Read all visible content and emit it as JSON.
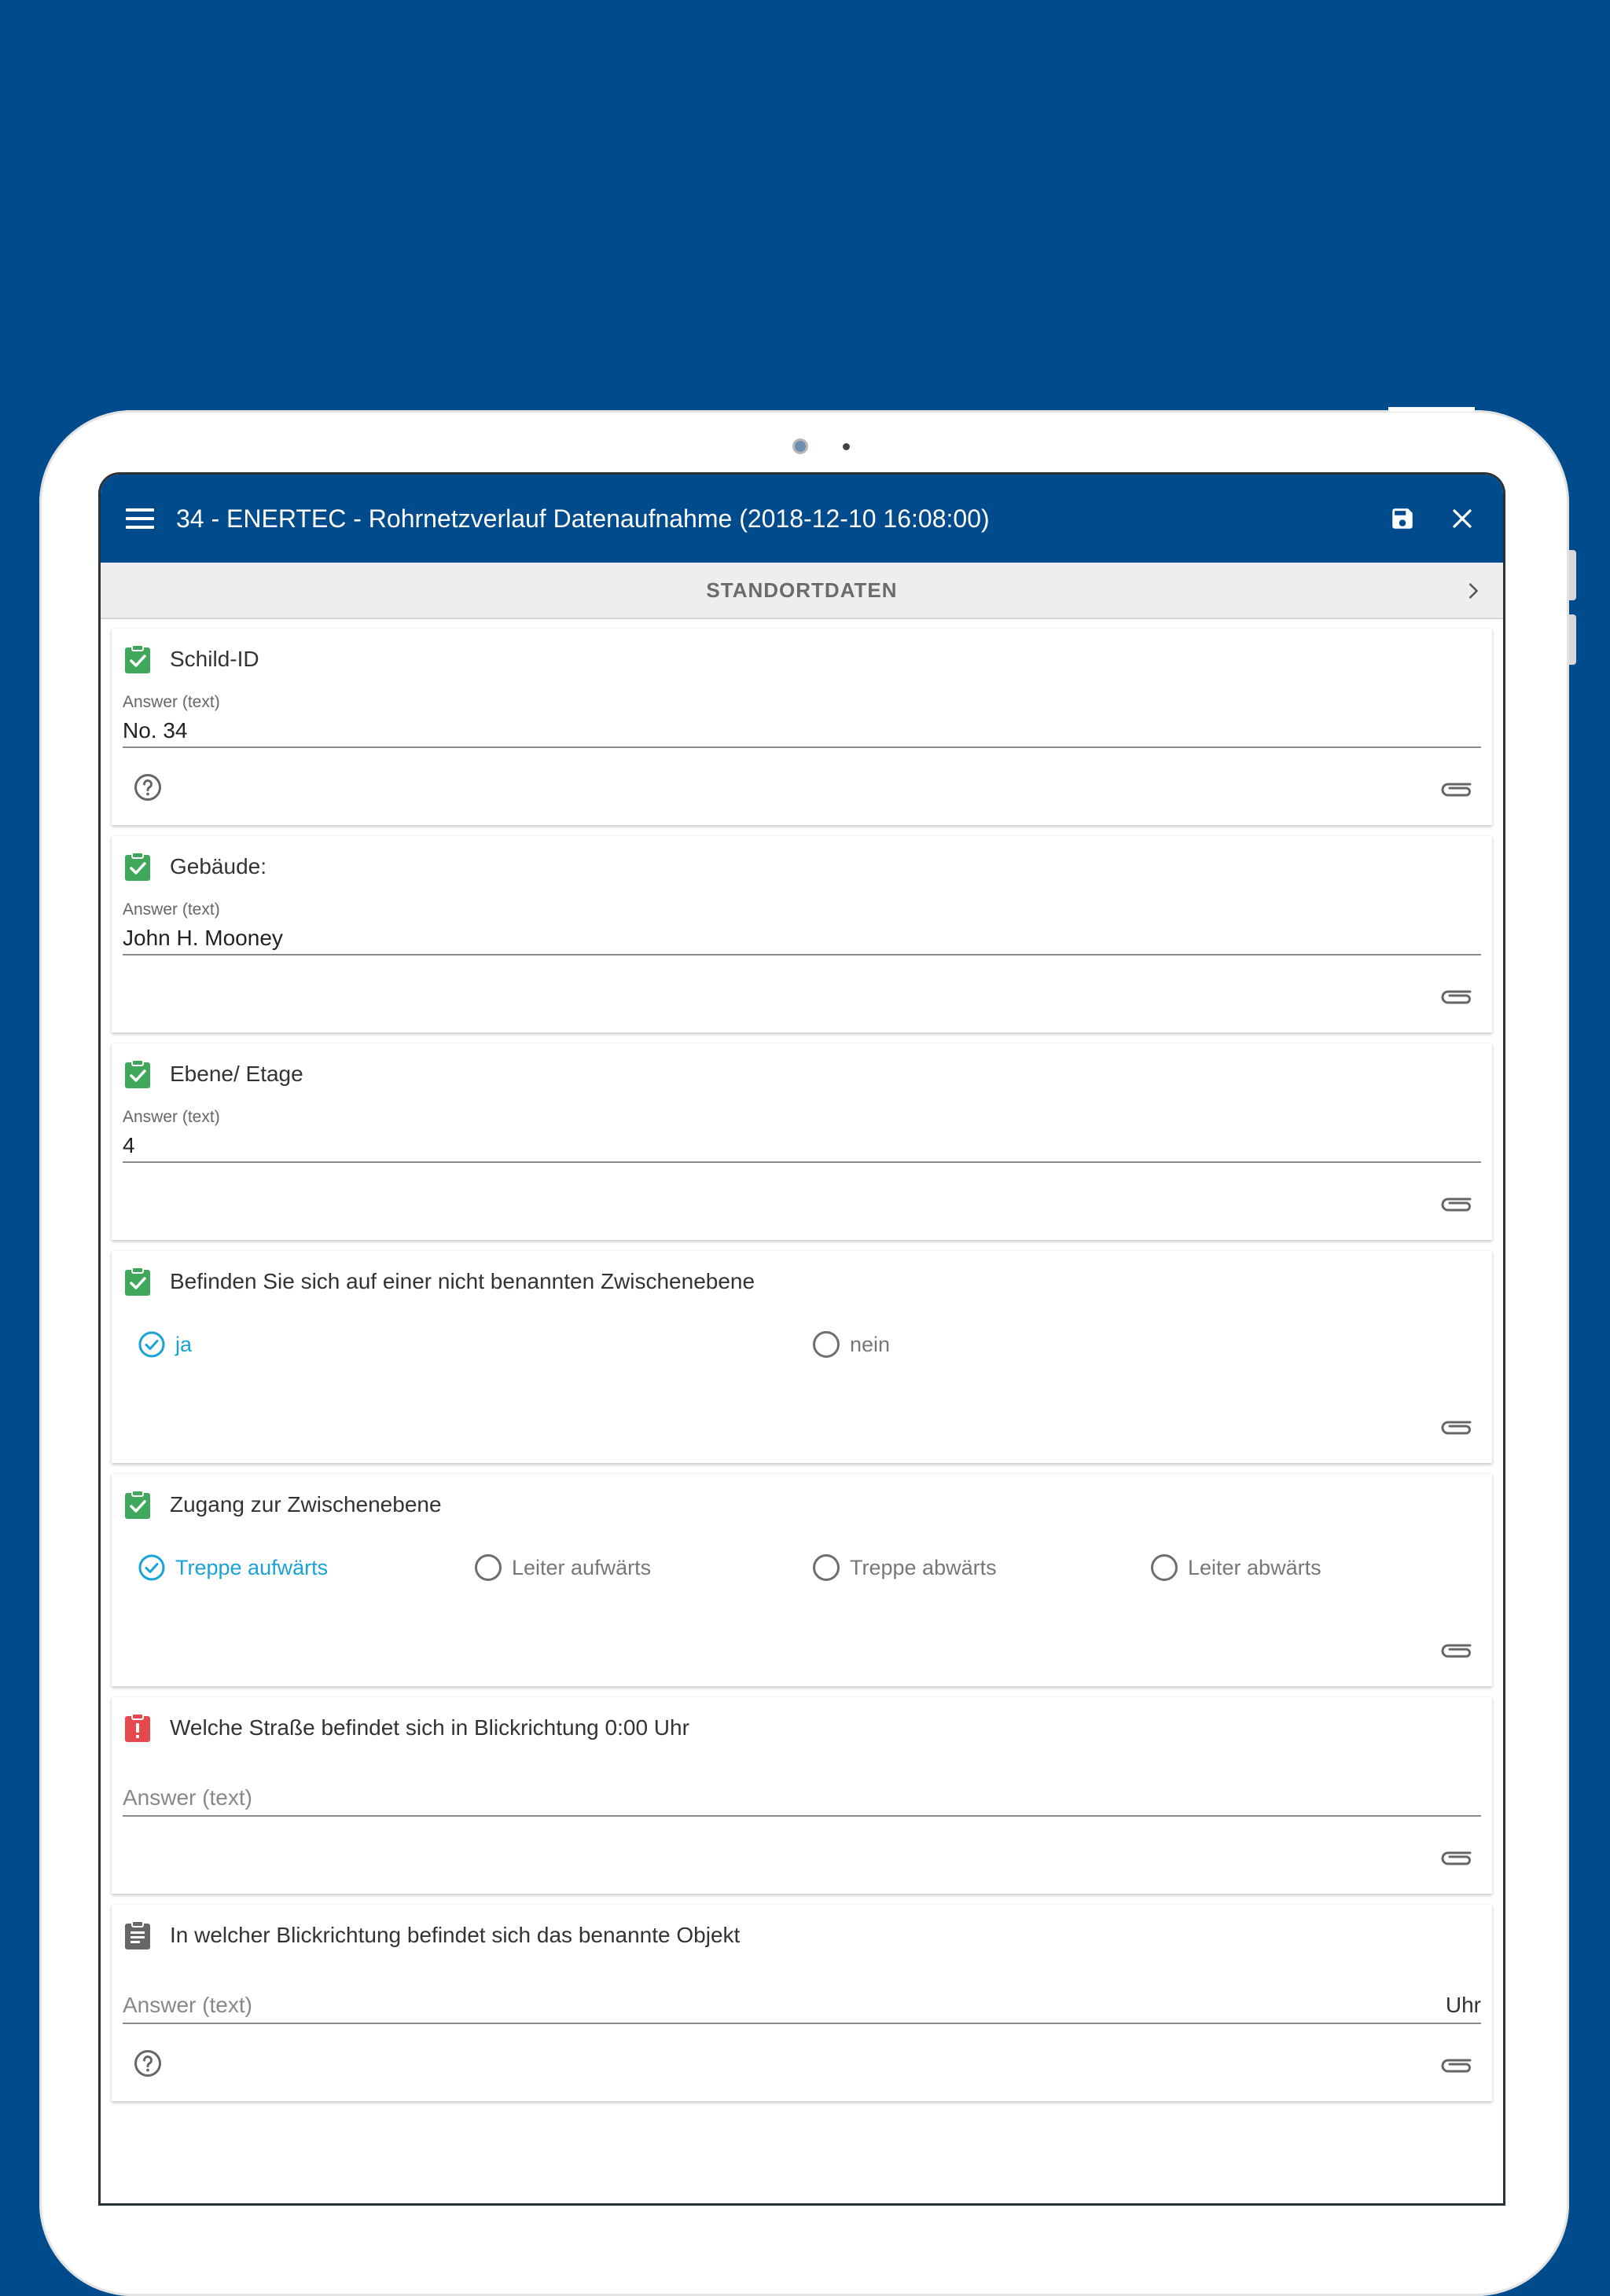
{
  "app": {
    "title": "34 - ENERTEC - Rohrnetzverlauf Datenaufnahme (2018-12-10 16:08:00)",
    "menu_icon": "menu-icon",
    "save_icon": "save-icon",
    "close_icon": "close-icon",
    "accent_color": "#004b8c"
  },
  "section": {
    "title": "STANDORTDATEN",
    "next_icon": "chevron-right-icon"
  },
  "status_colors": {
    "done": "#3fa85c",
    "error": "#e5484d",
    "pending": "#666666",
    "selected": "#19a2d8"
  },
  "questions": [
    {
      "label": "Schild-ID",
      "status": "done",
      "field_label": "Answer (text)",
      "value": "No. 34",
      "has_help": true
    },
    {
      "label": "Gebäude:",
      "status": "done",
      "field_label": "Answer (text)",
      "value": "John H. Mooney",
      "has_help": false
    },
    {
      "label": "Ebene/ Etage",
      "status": "done",
      "field_label": "Answer (text)",
      "value": "4",
      "has_help": false
    },
    {
      "label": "Befinden Sie sich auf einer nicht benannten Zwischenebene",
      "status": "done",
      "options": [
        {
          "label": "ja",
          "checked": true
        },
        {
          "label": "nein",
          "checked": false
        }
      ]
    },
    {
      "label": "Zugang zur Zwischenebene",
      "status": "done",
      "options": [
        {
          "label": "Treppe aufwärts",
          "checked": true
        },
        {
          "label": "Leiter aufwärts",
          "checked": false
        },
        {
          "label": "Treppe abwärts",
          "checked": false
        },
        {
          "label": "Leiter abwärts",
          "checked": false
        }
      ]
    },
    {
      "label": "Welche Straße befindet sich in Blickrichtung 0:00 Uhr",
      "status": "error",
      "placeholder": "Answer (text)",
      "value": ""
    },
    {
      "label": "In welcher Blickrichtung befindet sich das benannte Objekt",
      "status": "pending",
      "placeholder": "Answer (text)",
      "unit": "Uhr",
      "has_help": true
    }
  ]
}
